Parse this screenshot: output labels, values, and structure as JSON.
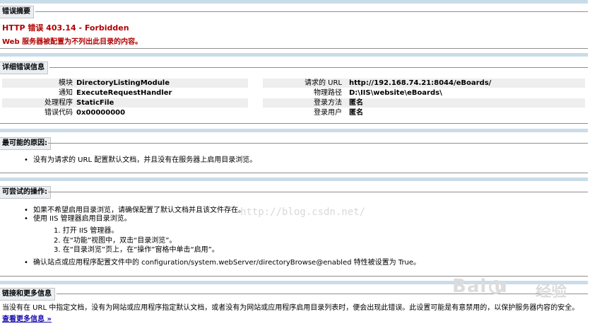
{
  "summary": {
    "heading": "错误摘要",
    "title": "HTTP 错误 403.14 - Forbidden",
    "message": "Web 服务器被配置为不列出此目录的内容。"
  },
  "details": {
    "heading": "详细错误信息",
    "left": [
      {
        "key": "模块",
        "value": "DirectoryListingModule"
      },
      {
        "key": "通知",
        "value": "ExecuteRequestHandler"
      },
      {
        "key": "处理程序",
        "value": "StaticFile"
      },
      {
        "key": "错误代码",
        "value": "0x00000000"
      }
    ],
    "right": [
      {
        "key": "请求的 URL",
        "value": "http://192.168.74.21:8044/eBoards/"
      },
      {
        "key": "物理路径",
        "value": "D:\\IIS\\website\\eBoards\\"
      },
      {
        "key": "登录方法",
        "value": "匿名"
      },
      {
        "key": "登录用户",
        "value": "匿名"
      }
    ]
  },
  "causes": {
    "heading": "最可能的原因:",
    "items": [
      "没有为请求的 URL 配置默认文档，并且没有在服务器上启用目录浏览。"
    ]
  },
  "actions": {
    "heading": "可尝试的操作:",
    "items": [
      "如果不希望启用目录浏览，请确保配置了默认文档并且该文件存在。",
      "使用 IIS 管理器启用目录浏览。"
    ],
    "steps": [
      "1.  打开 IIS 管理器。",
      "2.  在“功能”视图中，双击“目录浏览”。",
      "3.  在“目录浏览”页上，在“操作”窗格中单击“启用”。"
    ],
    "last_item": "确认站点或应用程序配置文件中的 configuration/system.webServer/directoryBrowse@enabled 特性被设置为 True。"
  },
  "links": {
    "heading": "链接和更多信息",
    "text": "当没有在 URL 中指定文档，没有为网站或应用程序指定默认文档，或者没有为网站或应用程序启用目录列表时，便会出现此错误。此设置可能是有意禁用的，以保护服务器内容的安全。",
    "more": "查看更多信息 »"
  },
  "watermark": {
    "url": "http://blog.csdn.net/",
    "logo": "Bai  u",
    "jingyan": "经验"
  },
  "colors": {
    "error_red": "#b00000",
    "band_blue": "#c9dce9",
    "label_bg": "#e9eef3",
    "row_shade": "#eeeeee",
    "link": "#1a0dab"
  }
}
